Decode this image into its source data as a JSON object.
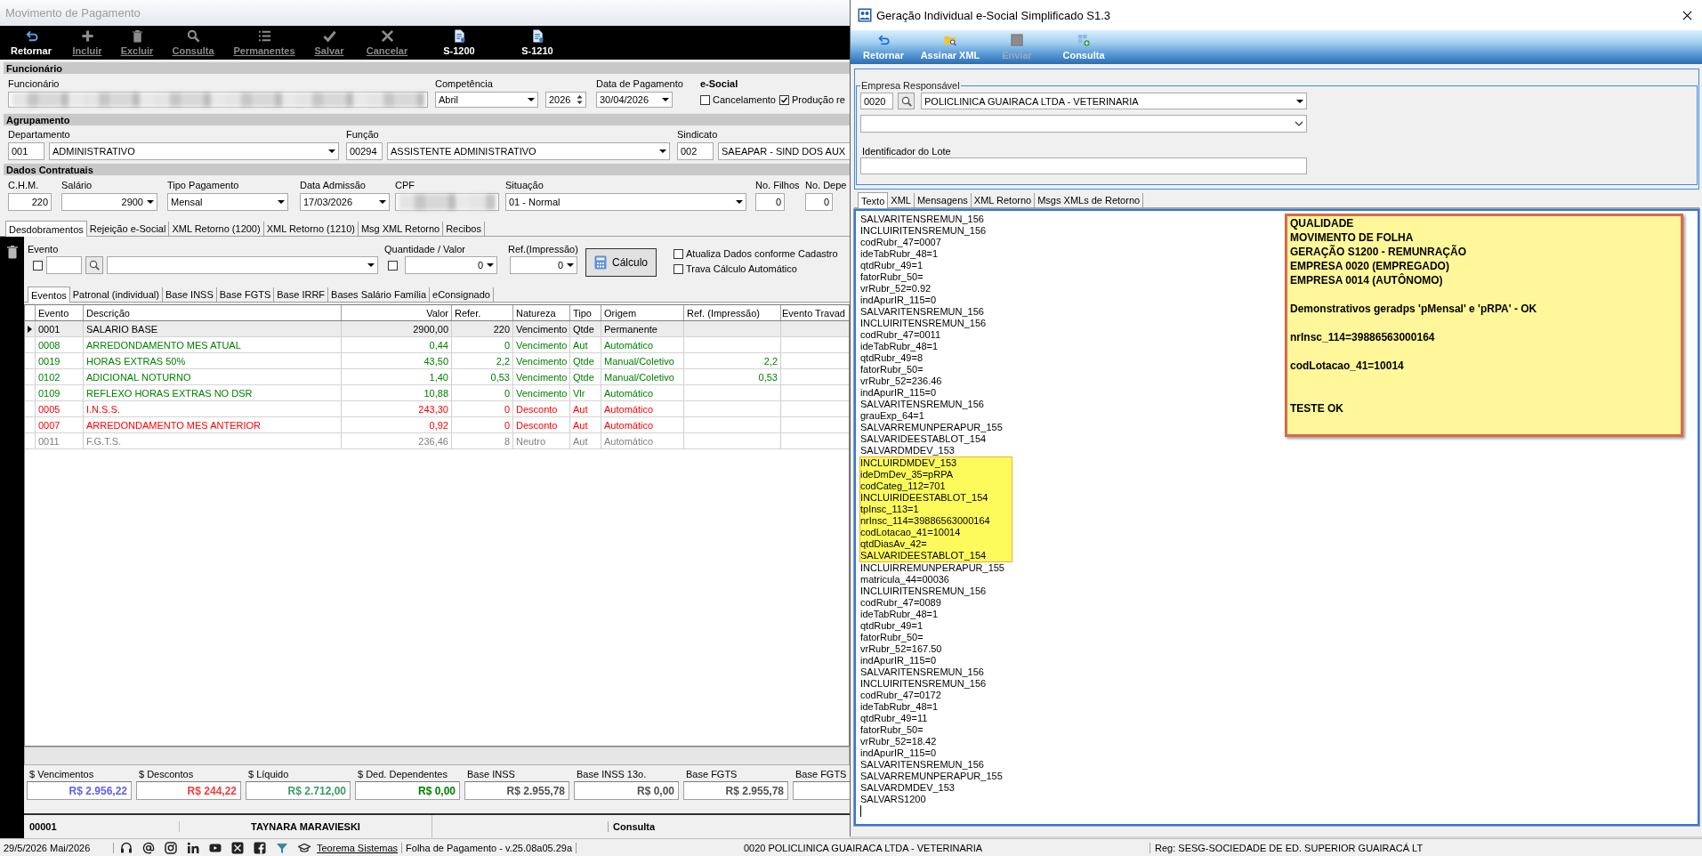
{
  "left_window": {
    "title": "Movimento de Pagamento",
    "toolbar": [
      {
        "label": "Retornar",
        "disabled": false
      },
      {
        "label": "Incluir",
        "disabled": true
      },
      {
        "label": "Excluir",
        "disabled": true
      },
      {
        "label": "Consulta",
        "disabled": true
      },
      {
        "label": "Permanentes",
        "disabled": true
      },
      {
        "label": "Salvar",
        "disabled": true
      },
      {
        "label": "Cancelar",
        "disabled": true
      },
      {
        "label": "S-1200",
        "disabled": false
      },
      {
        "label": "S-1210",
        "disabled": false
      }
    ],
    "employee_section": {
      "title": "Funcionário",
      "employee_label": "Funcionário",
      "competence": {
        "label": "Competência",
        "month": "Abril",
        "year": "2026"
      },
      "payment_date": {
        "label": "Data de Pagamento",
        "value": "30/04/2026"
      },
      "esocial": {
        "label": "e-Social",
        "options": [
          {
            "label": "Cancelamento",
            "checked": false
          },
          {
            "label": "Produção re",
            "checked": true
          }
        ]
      }
    },
    "grouping_section": {
      "title": "Agrupamento",
      "fields": [
        {
          "label": "Departamento",
          "code": "001",
          "value": "ADMINISTRATIVO"
        },
        {
          "label": "Função",
          "code": "00294",
          "value": "ASSISTENTE ADMINISTRATIVO"
        },
        {
          "label": "Sindicato",
          "code": "002",
          "value": "SAEAPAR - SIND DOS AUX"
        }
      ]
    },
    "contract_section": {
      "title": "Dados Contratuais",
      "fields": [
        {
          "label": "C.H.M.",
          "value": "220",
          "kind": "number"
        },
        {
          "label": "Salário",
          "value": "2900",
          "kind": "number-dropdown"
        },
        {
          "label": "Tipo Pagamento",
          "value": "Mensal",
          "kind": "dropdown"
        },
        {
          "label": "Data Admissão",
          "value": "17/03/2026",
          "kind": "date"
        },
        {
          "label": "CPF",
          "kind": "blurred"
        },
        {
          "label": "Situação",
          "value": "01 - Normal",
          "kind": "dropdown"
        },
        {
          "label": "No. Filhos",
          "value": "0",
          "kind": "number"
        },
        {
          "label": "No. Depe",
          "value": "0",
          "kind": "number"
        }
      ]
    },
    "tabs": [
      {
        "label": "Desdobramentos",
        "selected": true
      },
      {
        "label": "Rejeição e-Social",
        "selected": false
      },
      {
        "label": "XML Retorno (1200)",
        "selected": false
      },
      {
        "label": "XML Retorno (1210)",
        "selected": false
      },
      {
        "label": "Msg XML Retorno",
        "selected": false
      },
      {
        "label": "Recibos",
        "selected": false
      }
    ],
    "event_entry": {
      "event_label": "Evento",
      "event_checked": false,
      "quantity_label": "Quantidade / Valor",
      "quantity_checked": false,
      "quantity_value": "0",
      "print_ref_label": "Ref.(Impressão)",
      "print_ref_value": "0",
      "calc_button": "Cálculo",
      "options": [
        {
          "label": "Atualiza Dados conforme Cadastro",
          "checked": false
        },
        {
          "label": "Trava Cálculo Automático",
          "checked": false
        }
      ]
    },
    "subtabs": [
      {
        "label": "Eventos",
        "selected": true
      },
      {
        "label": "Patronal (individual)",
        "selected": false
      },
      {
        "label": "Base INSS",
        "selected": false
      },
      {
        "label": "Base FGTS",
        "selected": false
      },
      {
        "label": "Base IRRF",
        "selected": false
      },
      {
        "label": "Bases Salário Família",
        "selected": false
      },
      {
        "label": "eConsignado",
        "selected": false
      }
    ],
    "table": {
      "columns": [
        "Evento",
        "Descrição",
        "Valor",
        "Refer.",
        "Natureza",
        "Tipo",
        "Origem",
        "Ref. (Impressão)",
        "Evento Travad"
      ],
      "rows": [
        {
          "event": "0001",
          "description": "SALARIO BASE",
          "value": "2900,00",
          "ref": "220",
          "nature": "Vencimento",
          "type": "Qtde",
          "origin": "Permanente",
          "color": "#000000",
          "selected": true
        },
        {
          "event": "0008",
          "description": "ARREDONDAMENTO MES ATUAL",
          "value": "0,44",
          "ref": "0",
          "nature": "Vencimento",
          "type": "Aut",
          "origin": "Automático",
          "color": "#008000",
          "selected": false
        },
        {
          "event": "0019",
          "description": "HORAS EXTRAS 50%",
          "value": "43,50",
          "ref": "2,2",
          "nature": "Vencimento",
          "type": "Qtde",
          "origin": "Manual/Coletivo",
          "print_ref": "2,2",
          "color": "#008000",
          "selected": false
        },
        {
          "event": "0102",
          "description": "ADICIONAL NOTURNO",
          "value": "1,40",
          "ref": "0,53",
          "nature": "Vencimento",
          "type": "Qtde",
          "origin": "Manual/Coletivo",
          "print_ref": "0,53",
          "color": "#008000",
          "selected": false
        },
        {
          "event": "0109",
          "description": "REFLEXO HORAS EXTRAS NO DSR",
          "value": "10,88",
          "ref": "0",
          "nature": "Vencimento",
          "type": "Vlr",
          "origin": "Automático",
          "color": "#008000",
          "selected": false
        },
        {
          "event": "0005",
          "description": "I.N.S.S.",
          "value": "243,30",
          "ref": "0",
          "nature": "Desconto",
          "type": "Aut",
          "origin": "Automático",
          "color": "#ff0000",
          "selected": false
        },
        {
          "event": "0007",
          "description": "ARREDONDAMENTO MES ANTERIOR",
          "value": "0,92",
          "ref": "0",
          "nature": "Desconto",
          "type": "Aut",
          "origin": "Automático",
          "color": "#ff0000",
          "selected": false
        },
        {
          "event": "0011",
          "description": "F.G.T.S.",
          "value": "236,46",
          "ref": "8",
          "nature": "Neutro",
          "type": "Aut",
          "origin": "Automático",
          "color": "#808080",
          "selected": false
        }
      ]
    },
    "totals": [
      {
        "label": "$ Vencimentos",
        "value": "R$ 2.956,22",
        "color": "#6060ee"
      },
      {
        "label": "$ Descontos",
        "value": "R$ 244,22",
        "color": "#f03c3c"
      },
      {
        "label": "$ Líquido",
        "value": "R$ 2.712,00",
        "color": "#3a9a6a"
      },
      {
        "label": "$ Ded. Dependentes",
        "value": "R$ 0,00",
        "color": "#008000"
      },
      {
        "label": "Base INSS",
        "value": "R$ 2.955,78",
        "color": "#505050"
      },
      {
        "label": "Base INSS 13o.",
        "value": "R$ 0,00",
        "color": "#505050"
      },
      {
        "label": "Base FGTS",
        "value": "R$ 2.955,78",
        "color": "#505050"
      },
      {
        "label": "Base FGTS"
      }
    ],
    "footer": {
      "code": "00001",
      "name": "TAYNARA MARAVIESKI",
      "mode": "Consulta"
    }
  },
  "right_window": {
    "title": "Geração Individual e-Social Simplificado S1.3",
    "toolbar": [
      {
        "label": "Retornar",
        "disabled": false
      },
      {
        "label": "Assinar XML",
        "disabled": false
      },
      {
        "label": "Enviar",
        "disabled": true
      },
      {
        "label": "Consulta",
        "disabled": false
      }
    ],
    "company_group": {
      "legend": "Empresa Responsável",
      "code": "0020",
      "company": "POLICLINICA GUAIRACA LTDA - VETERINARIA",
      "batch_label": "Identificador do Lote"
    },
    "tabs": [
      {
        "label": "Texto",
        "selected": true
      },
      {
        "label": "XML",
        "selected": false
      },
      {
        "label": "Mensagens",
        "selected": false
      },
      {
        "label": "XML Retorno",
        "selected": false
      },
      {
        "label": "Msgs XMLs de Retorno",
        "selected": false
      }
    ],
    "log_lines": [
      {
        "text": "SALVARITENSREMUN_156",
        "highlighted": false
      },
      {
        "text": "INCLUIRITENSREMUN_156",
        "highlighted": false
      },
      {
        "text": "codRubr_47=0007",
        "highlighted": false
      },
      {
        "text": "ideTabRubr_48=1",
        "highlighted": false
      },
      {
        "text": "qtdRubr_49=1",
        "highlighted": false
      },
      {
        "text": "fatorRubr_50=",
        "highlighted": false
      },
      {
        "text": "vrRubr_52=0.92",
        "highlighted": false
      },
      {
        "text": "indApurIR_115=0",
        "highlighted": false
      },
      {
        "text": "SALVARITENSREMUN_156",
        "highlighted": false
      },
      {
        "text": "INCLUIRITENSREMUN_156",
        "highlighted": false
      },
      {
        "text": "codRubr_47=0011",
        "highlighted": false
      },
      {
        "text": "ideTabRubr_48=1",
        "highlighted": false
      },
      {
        "text": "qtdRubr_49=8",
        "highlighted": false
      },
      {
        "text": "fatorRubr_50=",
        "highlighted": false
      },
      {
        "text": "vrRubr_52=236.46",
        "highlighted": false
      },
      {
        "text": "indApurIR_115=0",
        "highlighted": false
      },
      {
        "text": "SALVARITENSREMUN_156",
        "highlighted": false
      },
      {
        "text": "grauExp_64=1",
        "highlighted": false
      },
      {
        "text": "SALVARREMUNPERAPUR_155",
        "highlighted": false
      },
      {
        "text": "SALVARIDEESTABLOT_154",
        "highlighted": false
      },
      {
        "text": "SALVARDMDEV_153",
        "highlighted": false
      },
      {
        "text": "INCLUIRDMDEV_153",
        "highlighted": true
      },
      {
        "text": "ideDmDev_35=pRPA",
        "highlighted": true
      },
      {
        "text": "codCateg_112=701",
        "highlighted": true
      },
      {
        "text": "INCLUIRIDEESTABLOT_154",
        "highlighted": true
      },
      {
        "text": "tpInsc_113=1",
        "highlighted": true
      },
      {
        "text": "nrInsc_114=39886563000164",
        "highlighted": true
      },
      {
        "text": "codLotacao_41=10014",
        "highlighted": true
      },
      {
        "text": "qtdDiasAv_42=",
        "highlighted": true
      },
      {
        "text": "SALVARIDEESTABLOT_154",
        "highlighted": true
      },
      {
        "text": "INCLUIRREMUNPERAPUR_155",
        "highlighted": false
      },
      {
        "text": "matricula_44=00036",
        "highlighted": false
      },
      {
        "text": "INCLUIRITENSREMUN_156",
        "highlighted": false
      },
      {
        "text": "codRubr_47=0089",
        "highlighted": false
      },
      {
        "text": "ideTabRubr_48=1",
        "highlighted": false
      },
      {
        "text": "qtdRubr_49=1",
        "highlighted": false
      },
      {
        "text": "fatorRubr_50=",
        "highlighted": false
      },
      {
        "text": "vrRubr_52=167.50",
        "highlighted": false
      },
      {
        "text": "indApurIR_115=0",
        "highlighted": false
      },
      {
        "text": "SALVARITENSREMUN_156",
        "highlighted": false
      },
      {
        "text": "INCLUIRITENSREMUN_156",
        "highlighted": false
      },
      {
        "text": "codRubr_47=0172",
        "highlighted": false
      },
      {
        "text": "ideTabRubr_48=1",
        "highlighted": false
      },
      {
        "text": "qtdRubr_49=11",
        "highlighted": false
      },
      {
        "text": "fatorRubr_50=",
        "highlighted": false
      },
      {
        "text": "vrRubr_52=18.42",
        "highlighted": false
      },
      {
        "text": "indApurIR_115=0",
        "highlighted": false
      },
      {
        "text": "SALVARITENSREMUN_156",
        "highlighted": false
      },
      {
        "text": "SALVARREMUNPERAPUR_155",
        "highlighted": false
      },
      {
        "text": "SALVARDMDEV_153",
        "highlighted": false
      },
      {
        "text": "SALVARS1200",
        "highlighted": false
      }
    ],
    "note": "QUALIDADE\nMOVIMENTO DE FOLHA\nGERAÇÃO S1200 - REMUNRAÇÃO\nEMPRESA 0020 (EMPREGADO)\nEMPRESA 0014 (AUTÔNOMO)\n\nDemonstrativos geradps 'pMensal' e 'pRPA' - OK\n\nnrInsc_114=39886563000164\n\ncodLotacao_41=10014\n\n\nTESTE OK"
  },
  "status_bar": {
    "date": "29/5/2026 Mai/2026",
    "link": "Teorema Sistemas",
    "version": "Folha de Pagamento - v.25.08a05.29a",
    "company": "0020 POLICLINICA GUAIRACA LTDA - VETERINARIA",
    "registration": "Reg: SESG-SOCIEDADE DE ED. SUPERIOR GUAIRACÁ LT"
  }
}
